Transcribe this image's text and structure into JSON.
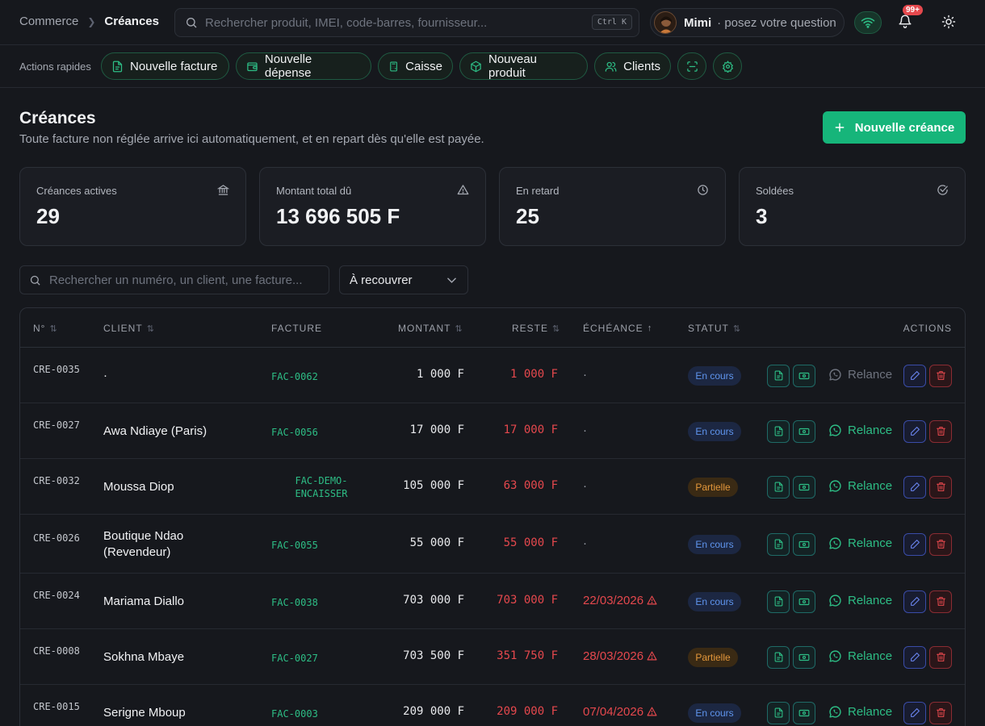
{
  "breadcrumb": {
    "root": "Commerce",
    "current": "Créances"
  },
  "global_search": {
    "placeholder": "Rechercher produit, IMEI, code-barres, fournisseur...",
    "shortcut": "Ctrl K"
  },
  "assistant": {
    "name": "Mimi",
    "prompt": "· posez votre question"
  },
  "notifications": {
    "count": "99+"
  },
  "quick_actions": {
    "label": "Actions rapides",
    "items": [
      {
        "label": "Nouvelle facture",
        "icon": "file-text-icon"
      },
      {
        "label": "Nouvelle dépense",
        "icon": "wallet-icon"
      },
      {
        "label": "Caisse",
        "icon": "calculator-icon"
      },
      {
        "label": "Nouveau produit",
        "icon": "package-icon"
      },
      {
        "label": "Clients",
        "icon": "users-icon"
      }
    ],
    "icon_buttons": [
      "scan-icon",
      "gear-icon"
    ]
  },
  "page": {
    "title": "Créances",
    "subtitle": "Toute facture non réglée arrive ici automatiquement, et en repart dès qu'elle est payée.",
    "new_button": "Nouvelle créance"
  },
  "stats": [
    {
      "label": "Créances actives",
      "value": "29",
      "icon": "bank-icon"
    },
    {
      "label": "Montant total dû",
      "value": "13 696 505 F",
      "icon": "alert-triangle-icon"
    },
    {
      "label": "En retard",
      "value": "25",
      "icon": "clock-icon"
    },
    {
      "label": "Soldées",
      "value": "3",
      "icon": "check-circle-icon"
    }
  ],
  "filters": {
    "search_placeholder": "Rechercher un numéro, un client, une facture...",
    "status_filter": "À recouvrer"
  },
  "table": {
    "headers": {
      "num": "N°",
      "client": "CLIENT",
      "facture": "FACTURE",
      "montant": "MONTANT",
      "reste": "RESTE",
      "echeance": "ÉCHÉANCE",
      "statut": "STATUT",
      "actions": "ACTIONS"
    },
    "relance_label": "Relance",
    "rows": [
      {
        "num": "CRE-0035",
        "client": "·",
        "facture": "FAC-0062",
        "montant": "1 000 F",
        "reste": "1 000 F",
        "echeance": "·",
        "late": false,
        "statut": "En cours",
        "relance_enabled": false
      },
      {
        "num": "CRE-0027",
        "client": "Awa Ndiaye (Paris)",
        "facture": "FAC-0056",
        "montant": "17 000 F",
        "reste": "17 000 F",
        "echeance": "·",
        "late": false,
        "statut": "En cours",
        "relance_enabled": true
      },
      {
        "num": "CRE-0032",
        "client": "Moussa Diop",
        "facture": "FAC-DEMO-ENCAISSER",
        "montant": "105 000 F",
        "reste": "63 000 F",
        "echeance": "·",
        "late": false,
        "statut": "Partielle",
        "relance_enabled": true
      },
      {
        "num": "CRE-0026",
        "client": "Boutique Ndao (Revendeur)",
        "facture": "FAC-0055",
        "montant": "55 000 F",
        "reste": "55 000 F",
        "echeance": "·",
        "late": false,
        "statut": "En cours",
        "relance_enabled": true
      },
      {
        "num": "CRE-0024",
        "client": "Mariama Diallo",
        "facture": "FAC-0038",
        "montant": "703 000 F",
        "reste": "703 000 F",
        "echeance": "22/03/2026",
        "late": true,
        "statut": "En cours",
        "relance_enabled": true
      },
      {
        "num": "CRE-0008",
        "client": "Sokhna Mbaye",
        "facture": "FAC-0027",
        "montant": "703 500 F",
        "reste": "351 750 F",
        "echeance": "28/03/2026",
        "late": true,
        "statut": "Partielle",
        "relance_enabled": true
      },
      {
        "num": "CRE-0015",
        "client": "Serigne Mboup",
        "facture": "FAC-0003",
        "montant": "209 000 F",
        "reste": "209 000 F",
        "echeance": "07/04/2026",
        "late": true,
        "statut": "En cours",
        "relance_enabled": true
      }
    ]
  },
  "colors": {
    "accent": "#16b57a",
    "danger": "#e5484d",
    "info": "#5f95ee",
    "warning": "#e5983b"
  }
}
